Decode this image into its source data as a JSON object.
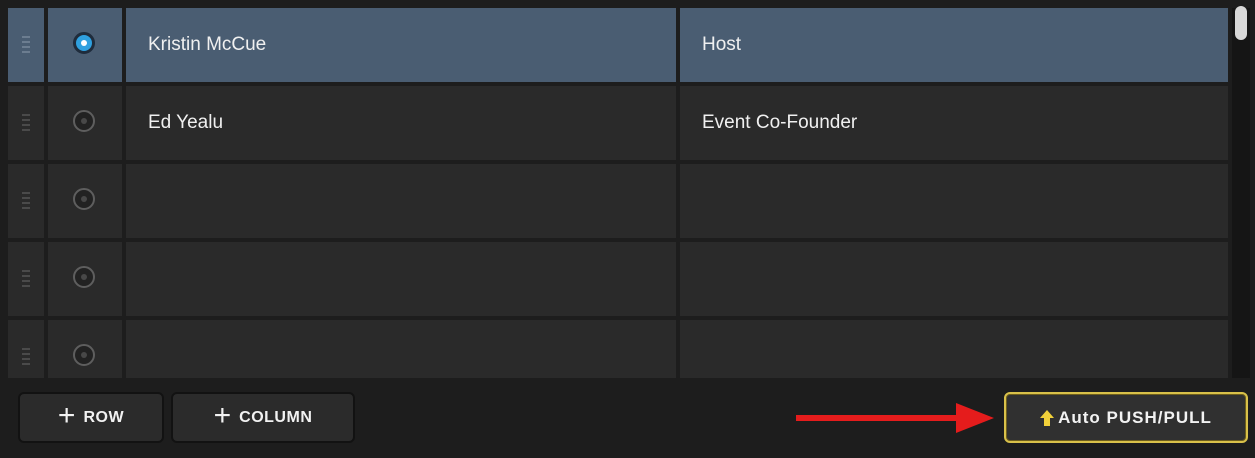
{
  "rows": [
    {
      "name": "Kristin McCue",
      "title": "Host",
      "selected": true
    },
    {
      "name": "Ed Yealu",
      "title": "Event Co-Founder",
      "selected": false
    },
    {
      "name": "",
      "title": "",
      "selected": false
    },
    {
      "name": "",
      "title": "",
      "selected": false
    },
    {
      "name": "",
      "title": "",
      "selected": false
    }
  ],
  "toolbar": {
    "add_row_label": "ROW",
    "add_column_label": "COLUMN",
    "auto_push_pull_label": "Auto PUSH/PULL"
  },
  "colors": {
    "selected_row": "#4a5d72",
    "radio_selected": "#2fa0df",
    "annotation_arrow": "#e51c1c",
    "auto_button_border": "#d9c14a",
    "auto_icon": "#f2d13a"
  },
  "icons": {
    "add": "plus-icon",
    "drag": "drag-handle-icon",
    "push_pull": "arrow-up-icon",
    "annotation": "red-arrow-icon"
  }
}
